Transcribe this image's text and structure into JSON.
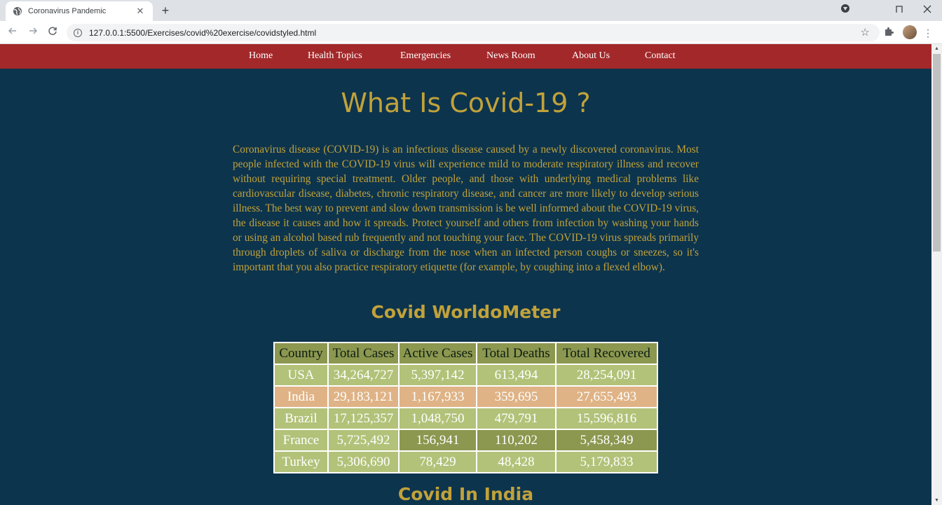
{
  "browser": {
    "tab_title": "Coronavirus Pandemic",
    "tab_close": "✕",
    "new_tab": "+",
    "url": "127.0.0.1:5500/Exercises/covid%20exercise/covidstyled.html"
  },
  "nav": {
    "items": [
      "Home",
      "Health Topics",
      "Emergencies",
      "News Room",
      "About Us",
      "Contact"
    ]
  },
  "page": {
    "title": "What Is Covid-19 ?",
    "intro": "Coronavirus disease (COVID-19) is an infectious disease caused by a newly discovered coronavirus. Most people infected with the COVID-19 virus will experience mild to moderate respiratory illness and recover without requiring special treatment. Older people, and those with underlying medical problems like cardiovascular disease, diabetes, chronic respiratory disease, and cancer are more likely to develop serious illness. The best way to prevent and slow down transmission is be well informed about the COVID-19 virus, the disease it causes and how it spreads. Protect yourself and others from infection by washing your hands or using an alcohol based rub frequently and not touching your face. The COVID-19 virus spreads primarily through droplets of saliva or discharge from the nose when an infected person coughs or sneezes, so it's important that you also practice respiratory etiquette (for example, by coughing into a flexed elbow).",
    "worldometer_heading": "Covid WorldoMeter",
    "india_heading": "Covid In India"
  },
  "table": {
    "headers": [
      "Country",
      "Total Cases",
      "Active Cases",
      "Total Deaths",
      "Total Recovered"
    ],
    "rows": [
      [
        "USA",
        "34,264,727",
        "5,397,142",
        "613,494",
        "28,254,091"
      ],
      [
        "India",
        "29,183,121",
        "1,167,933",
        "359,695",
        "27,655,493"
      ],
      [
        "Brazil",
        "17,125,357",
        "1,048,750",
        "479,791",
        "15,596,816"
      ],
      [
        "France",
        "5,725,492",
        "156,941",
        "110,202",
        "5,458,349"
      ],
      [
        "Turkey",
        "5,306,690",
        "78,429",
        "48,428",
        "5,179,833"
      ]
    ]
  },
  "colors": {
    "nav_bg": "#a3282a",
    "page_bg": "#0d344d",
    "accent_gold": "#c1a23a",
    "table_light": "#b2c279",
    "table_dark": "#8c974f",
    "highlight_row": "#dfb386",
    "highlight_text": "#e11b2a"
  }
}
